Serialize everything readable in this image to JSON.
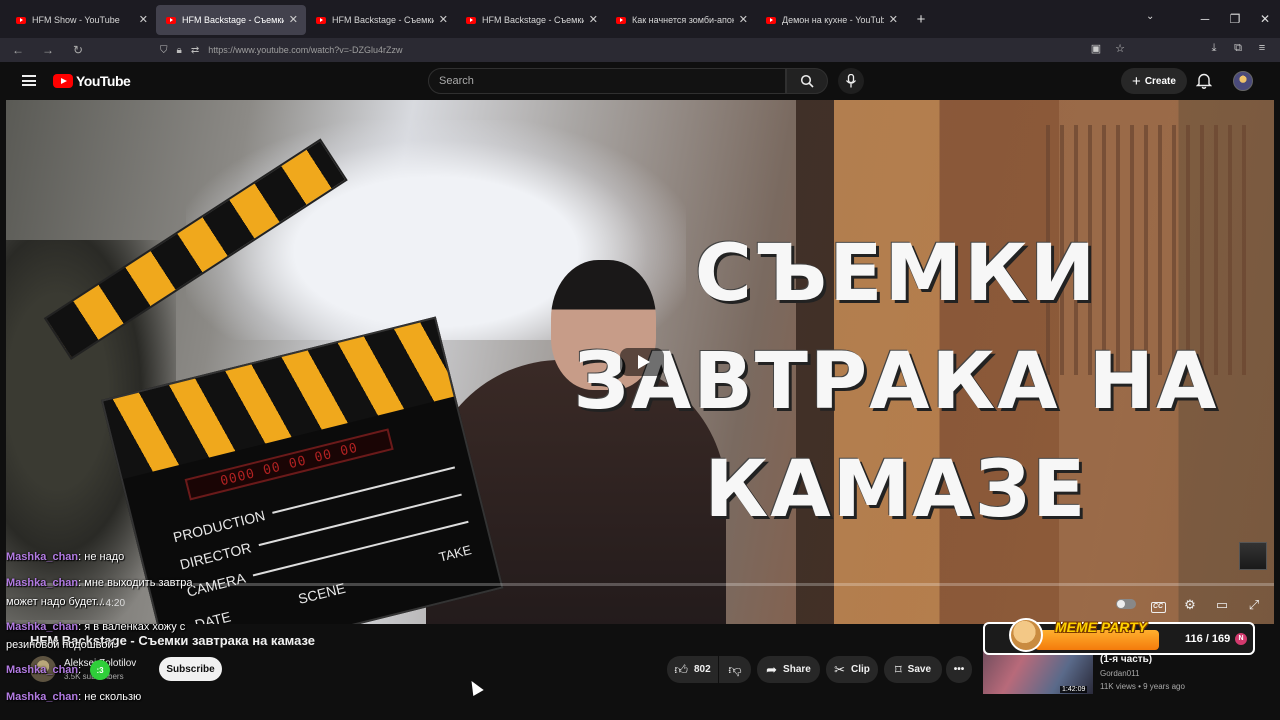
{
  "browser": {
    "tabs": [
      {
        "title": "HFM Show - YouTube",
        "active": false
      },
      {
        "title": "HFM Backstage - Съемки завтрака",
        "active": true
      },
      {
        "title": "HFM Backstage - Съемки курил",
        "active": false
      },
      {
        "title": "HFM Backstage - Съемки ремо",
        "active": false
      },
      {
        "title": "Как начнется зомби-апокалип",
        "active": false
      },
      {
        "title": "Демон на кухне - YouTube",
        "active": false
      }
    ],
    "url": "https://www.youtube.com/watch?v=-DZGlu4rZzw"
  },
  "youtube": {
    "logo_text": "YouTube",
    "search_placeholder": "Search",
    "create_label": "Create"
  },
  "video": {
    "overlay_title": [
      "СЪЕМКИ",
      "ЗАВТРАКА НА",
      "КАМАЗЕ"
    ],
    "clapper": {
      "timer": "0000 00 00 00 00",
      "lines": [
        "PRODUCTION",
        "DIRECTOR",
        "CAMERA"
      ],
      "scene": "SCENE",
      "take": "TAKE",
      "date": "DATE"
    },
    "time_display": "/ 4:20",
    "progress_fraction": 0.0,
    "title": "HFM Backstage - Съемки завтрака на камазе"
  },
  "channel": {
    "name": "Aleksei Zolotilov",
    "subs": "3.5K subscribers",
    "subscribe_label": "Subscribe"
  },
  "actions": {
    "likes": "802",
    "share": "Share",
    "clip": "Clip",
    "save": "Save"
  },
  "chat": [
    {
      "user": "Mashka_chan",
      "text": "не надо"
    },
    {
      "user": "Mashka_chan",
      "text": "мне выходить завтра"
    },
    {
      "user": "",
      "text": "может надо будет..."
    },
    {
      "user": "Mashka_chan",
      "text": "я в валенках хожу с"
    },
    {
      "user": "",
      "text": "резиновой подошвой"
    },
    {
      "user": "Mashka_chan",
      "text": ""
    },
    {
      "user": "Mashka_chan",
      "text": "не скользю"
    }
  ],
  "meme_party": {
    "label": "MEME PARTY",
    "count": "116 / 169"
  },
  "recommendation": {
    "title": "(1-я часть)",
    "channel": "Gordan011",
    "meta": "11K views • 9 years ago",
    "duration": "1:42:09"
  },
  "colors": {
    "yt_red": "#ff0000",
    "chat_user": "#b27be2",
    "meme_orange": "#f47b0c"
  }
}
